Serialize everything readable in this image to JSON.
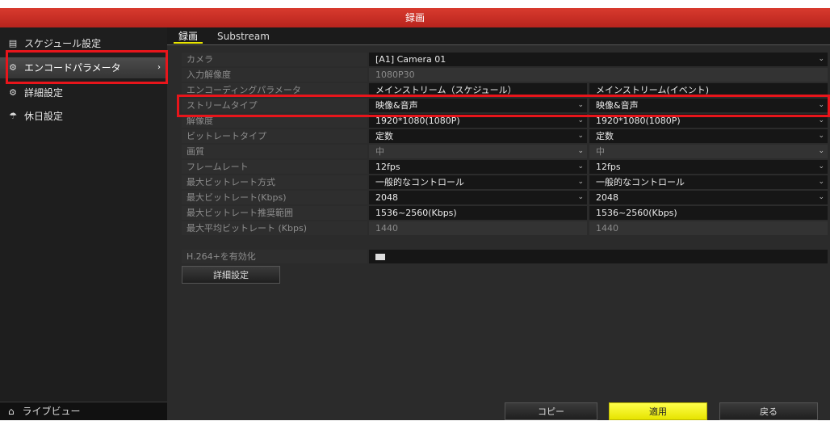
{
  "title": "録画",
  "sidebar": {
    "items": [
      {
        "icon": "calendar-icon",
        "glyph": "▤",
        "label": "スケジュール設定"
      },
      {
        "icon": "gear-icon",
        "glyph": "⚙",
        "label": "エンコードパラメータ",
        "arrow": "›"
      },
      {
        "icon": "settings-icon",
        "glyph": "⚙",
        "label": "詳細設定"
      },
      {
        "icon": "umbrella-icon",
        "glyph": "☂",
        "label": "休日設定"
      }
    ],
    "live_view": {
      "glyph": "⌂",
      "label": "ライブビュー"
    }
  },
  "tabs": [
    "録画",
    "Substream"
  ],
  "form": {
    "camera": {
      "label": "カメラ",
      "value": "[A1] Camera 01"
    },
    "input_resolution": {
      "label": "入力解像度",
      "value": "1080P30"
    },
    "encoding_param": {
      "label": "エンコーディングパラメータ",
      "main": "メインストリーム（スケジュール）",
      "event": "メインストリーム(イベント)"
    },
    "stream_type": {
      "label": "ストリームタイプ",
      "main": "映像&音声",
      "event": "映像&音声"
    },
    "resolution": {
      "label": "解像度",
      "main": "1920*1080(1080P)",
      "event": "1920*1080(1080P)"
    },
    "bitrate_type": {
      "label": "ビットレートタイプ",
      "main": "定数",
      "event": "定数"
    },
    "quality": {
      "label": "画質",
      "main": "中",
      "event": "中"
    },
    "frame_rate": {
      "label": "フレームレート",
      "main": "12fps",
      "event": "12fps"
    },
    "max_bitrate_mode": {
      "label": "最大ビットレート方式",
      "main": "一般的なコントロール",
      "event": "一般的なコントロール"
    },
    "max_bitrate": {
      "label": "最大ビットレート(Kbps)",
      "main": "2048",
      "event": "2048"
    },
    "recommended_range": {
      "label": "最大ビットレート推奨範囲",
      "main": "1536~2560(Kbps)",
      "event": "1536~2560(Kbps)"
    },
    "max_avg_bitrate": {
      "label": "最大平均ビットレート (Kbps)",
      "main": "1440",
      "event": "1440"
    },
    "h264plus": {
      "label": "H.264+を有効化"
    }
  },
  "buttons": {
    "advanced": "詳細設定",
    "copy": "コピー",
    "apply": "適用",
    "back": "戻る"
  },
  "dropdown_glyph": "⌄",
  "colors": {
    "titlebar": "#c62a22",
    "highlight_box": "#e8151b",
    "apply": "#f2ef10"
  }
}
